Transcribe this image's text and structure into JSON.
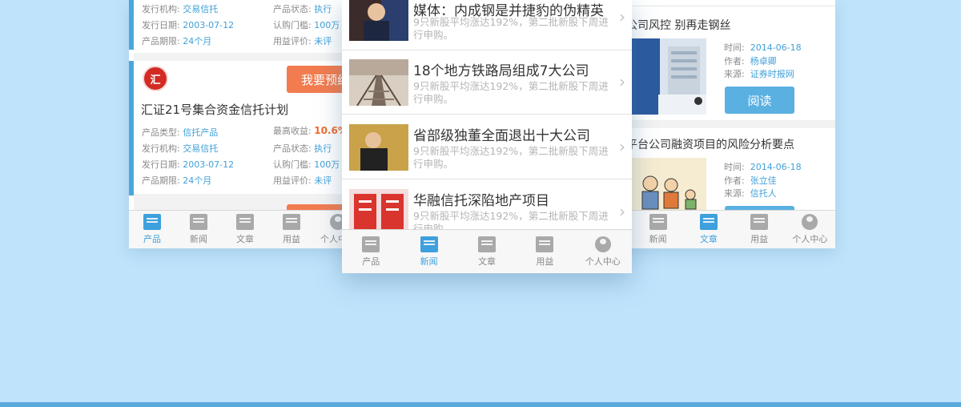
{
  "left_screen": {
    "card1": {
      "issuer_label": "发行机构:",
      "issuer": "交易信托",
      "status_label": "产品状态:",
      "status": "执行",
      "date_label": "发行日期:",
      "date": "2003-07-12",
      "threshold_label": "认购门槛:",
      "threshold": "100万",
      "term_label": "产品期限:",
      "term": "24个月",
      "rating_label": "用益评价:",
      "rating": "未评"
    },
    "card2": {
      "logo_text": "汇",
      "reserve_label": "我要预约",
      "title": "汇证21号集合资金信托计划",
      "type_label": "产品类型:",
      "type": "信托产品",
      "yield_label": "最高收益:",
      "yield": "10.6%",
      "issuer_label": "发行机构:",
      "issuer": "交易信托",
      "status_label": "产品状态:",
      "status": "执行",
      "date_label": "发行日期:",
      "date": "2003-07-12",
      "threshold_label": "认购门槛:",
      "threshold": "100万",
      "term_label": "产品期限:",
      "term": "24个月",
      "rating_label": "用益评价:",
      "rating": "未评"
    },
    "tabs": [
      {
        "label": "产品",
        "icon": "product-icon",
        "active": true
      },
      {
        "label": "新闻",
        "icon": "news-icon",
        "active": false
      },
      {
        "label": "文章",
        "icon": "article-icon",
        "active": false
      },
      {
        "label": "用益",
        "icon": "yongyi-icon",
        "active": false
      },
      {
        "label": "个人中心",
        "icon": "user-icon",
        "active": false
      }
    ]
  },
  "center_screen": {
    "news": [
      {
        "title": "媒体：内成钢是并捷豹的伪精英",
        "summary": "9只新股平均涨达192%，第二批新股下周进行申购。"
      },
      {
        "title": "18个地方铁路局组成7大公司",
        "summary": "9只新股平均涨达192%，第二批新股下周进行申购。"
      },
      {
        "title": "省部级独董全面退出十大公司",
        "summary": "9只新股平均涨达192%，第二批新股下周进行申购。"
      },
      {
        "title": "华融信托深陷地产项目",
        "summary": "9只新股平均涨达192%，第二批新股下周进行申购。"
      }
    ],
    "tabs": [
      {
        "label": "产品",
        "icon": "product-icon",
        "active": false
      },
      {
        "label": "新闻",
        "icon": "news-icon",
        "active": true
      },
      {
        "label": "文章",
        "icon": "article-icon",
        "active": false
      },
      {
        "label": "用益",
        "icon": "yongyi-icon",
        "active": false
      },
      {
        "label": "个人中心",
        "icon": "user-icon",
        "active": false
      }
    ]
  },
  "right_screen": {
    "article1": {
      "title": "公司风控 别再走钢丝",
      "time_label": "时间:",
      "time": "2014-06-18",
      "author_label": "作者:",
      "author": "杨卓卿",
      "source_label": "来源:",
      "source": "证券时报网",
      "read_label": "阅读"
    },
    "article2": {
      "title": "平台公司融资项目的风险分析要点",
      "time_label": "时间:",
      "time": "2014-06-18",
      "author_label": "作者:",
      "author": "张立佳",
      "source_label": "来源:",
      "source": "信托人"
    },
    "tabs": [
      {
        "label": "新闻",
        "icon": "news-icon",
        "active": false
      },
      {
        "label": "文章",
        "icon": "article-icon",
        "active": true
      },
      {
        "label": "用益",
        "icon": "yongyi-icon",
        "active": false
      },
      {
        "label": "个人中心",
        "icon": "user-icon",
        "active": false
      }
    ]
  },
  "colors": {
    "background": "#bfe3fb",
    "accent_blue": "#3ea0dc",
    "reserve_orange": "#f27c4f",
    "yield_orange": "#f06a2c"
  }
}
